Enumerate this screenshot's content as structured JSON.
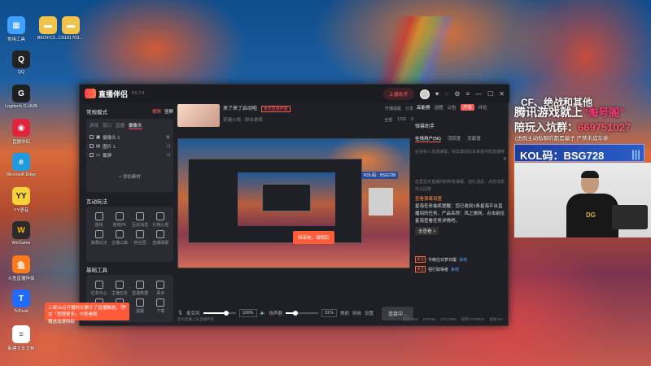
{
  "desktop": {
    "icons": [
      {
        "label": "常用工具",
        "color": "#3fa0ff"
      },
      {
        "label": "BEOFC2...",
        "color": "#f2c34a"
      },
      {
        "label": "C6181703...",
        "color": "#f2c34a"
      },
      {
        "label": "QQ",
        "color": "#2a2a2a"
      },
      {
        "label": "Logitech G HUB",
        "color": "#1f1f1f"
      },
      {
        "label": "直播伴侣",
        "color": "#e0243d"
      },
      {
        "label": "Microsoft Edge",
        "color": "#1f9be0"
      },
      {
        "label": "YY语音",
        "color": "#f7d23a"
      },
      {
        "label": "WeGame",
        "color": "#2b2b2b"
      },
      {
        "label": "斗鱼直播伴侣",
        "color": "#ff7a1a"
      },
      {
        "label": "ToDesk",
        "color": "#1f6bff"
      },
      {
        "label": "新建文本文档",
        "color": "#ffffff"
      }
    ]
  },
  "app": {
    "name": "直播伴侣",
    "version": "8.5.7.4",
    "topright": {
      "live_btn": "上播助手",
      "icons": [
        "gift-icon",
        "headset-icon",
        "settings-icon",
        "menu-icon",
        "minimize-icon",
        "maximize-icon",
        "close-icon"
      ]
    },
    "scene": {
      "title": "常规模式",
      "actions": [
        "横屏",
        "竖屏"
      ],
      "tabs": [
        "游戏",
        "窗口",
        "直播",
        "摄像头"
      ],
      "sources": [
        {
          "name": "摄像头 1",
          "icon": "camera-icon"
        },
        {
          "name": "图片 1",
          "icon": "image-icon"
        },
        {
          "name": "截屏",
          "icon": "screen-icon"
        }
      ],
      "add_source": "+ 添加素材"
    },
    "interact": {
      "title": "互动玩法",
      "items": [
        {
          "label": "连线",
          "icon": "link-icon"
        },
        {
          "label": "连线PK",
          "icon": "pk-icon"
        },
        {
          "label": "互动消息",
          "icon": "message-icon"
        },
        {
          "label": "礼物心愿",
          "icon": "gift-icon"
        },
        {
          "label": "弹幕玩法",
          "icon": "danmaku-icon"
        },
        {
          "label": "主播口袋",
          "icon": "pocket-icon"
        },
        {
          "label": "粉丝团",
          "icon": "fans-icon"
        },
        {
          "label": "直播弹幕",
          "icon": "barrage-icon"
        }
      ]
    },
    "basic": {
      "title": "基础工具",
      "items": [
        {
          "label": "任务中心",
          "icon": "task-icon"
        },
        {
          "label": "主播任务",
          "icon": "star-icon"
        },
        {
          "label": "直播数据",
          "icon": "data-icon"
        },
        {
          "label": "更多",
          "icon": "more-icon"
        },
        {
          "label": "清屏",
          "icon": "clear-icon"
        },
        {
          "label": "录制",
          "icon": "record-icon"
        },
        {
          "label": "提醒",
          "icon": "bell-icon"
        },
        {
          "label": "下载",
          "icon": "download-icon"
        }
      ]
    },
    "live": {
      "title": "来了来了启动啦",
      "badge": "更改直播封面",
      "category": "穿越火线 · 射击游戏",
      "stats": [
        "开播提醒",
        "分享"
      ],
      "stats2": [
        "全部",
        "1315",
        "0"
      ],
      "room_info": "直播伴侣",
      "preview_toast": "待审核，请稍后",
      "inner_kol": "KOL码：BSG728"
    },
    "controls": {
      "mic_label": "麦克风",
      "mic_pct": "100%",
      "speaker_label": "扬声器",
      "speaker_pct": "31%",
      "mic_level": 0.7,
      "speaker_level": 0.31,
      "btns": [
        "美颜",
        "特效",
        "设置"
      ],
      "go_live": "连接中..."
    },
    "statusbar": {
      "left": "您的直播上乐直播伴侣",
      "items": [
        "内存:46%",
        "FPS:60",
        "CPU:29%",
        "码率:5700kb/s",
        "丢帧:0%"
      ]
    },
    "right": {
      "tabs": [
        "高能榜",
        "话题",
        "公告"
      ],
      "extra": [
        "开场",
        "评论"
      ],
      "assist_title": "弹幕助手",
      "subtabs": [
        "在线用户(56)",
        "活跃度",
        "贡献值"
      ],
      "empty_text": "还没有人发送弹幕，快去邀请好友来看你的直播吧",
      "count": "0",
      "tip_text": "这里显示直播间的所有弹幕、送礼消息、点击消息可以回复",
      "link": "查看弹幕设置",
      "body": "星海任务抽奖提醒：您已收到1条星海平台直播间的任务，产品名称：风之旅网，点击前往星海查看任务详情吧。",
      "more_btn": "去查看 >",
      "tasks": [
        {
          "tag": "关注",
          "name": "今晚往日梦日醒",
          "action": "来啦"
        },
        {
          "tag": "关注",
          "name": "强行取得者",
          "action": "来啦"
        }
      ]
    },
    "toast": {
      "text": "上周18点开播时长累计了直播数据，可在「管理更多」中查看哦",
      "sub": "赠送加速特权"
    }
  },
  "overlay": {
    "line1": "CF、绝战和其他",
    "line2a": "腾讯游戏就上",
    "line2b": "\"淘号阁\"",
    "line3a": "陪玩入坑群：",
    "line3b": "669751027",
    "line4": "(进群主动私聊的都是骗子 严禁未成年参",
    "kol": "KOL码：BSG728",
    "shirt": "DG"
  }
}
